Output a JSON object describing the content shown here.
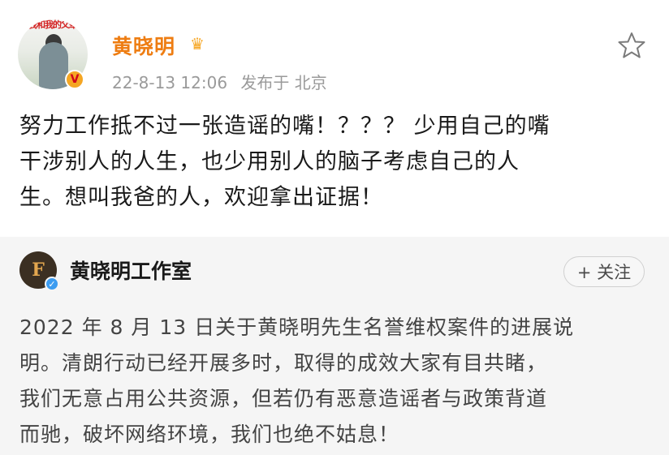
{
  "post": {
    "avatar_caption": "我和我的父辈",
    "username": "黄晓明",
    "date": "22-8-13 12:06",
    "location": "发布于 北京",
    "text_lines": [
      "努力工作抵不过一张造谣的嘴！？？？ 少用自己的嘴",
      "干涉别人的人生，也少用别人的脑子考虑自己的人",
      "生。想叫我爸的人，欢迎拿出证据！"
    ]
  },
  "quoted": {
    "name": "黄晓明工作室",
    "follow_label": "+ 关注",
    "text_lines": [
      "2022 年 8 月 13 日关于黄晓明先生名誉维权案件的进展说",
      "明。清朗行动已经开展多时，取得的成效大家有目共睹，",
      "我们无意占用公共资源，但若仍有恶意造谣者与政策背道",
      "而驰，破坏网络环境，我们也绝不姑息！"
    ]
  },
  "icons": {
    "star": "star-outline-icon",
    "crown": "crown-icon",
    "verified": "verified-badge-icon",
    "v_badge": "weibo-v-badge-icon"
  },
  "colors": {
    "username": "#ee7d12",
    "meta": "#9a9a9a",
    "quoted_bg": "#f5f5f5",
    "verified": "#3c9cf0"
  }
}
